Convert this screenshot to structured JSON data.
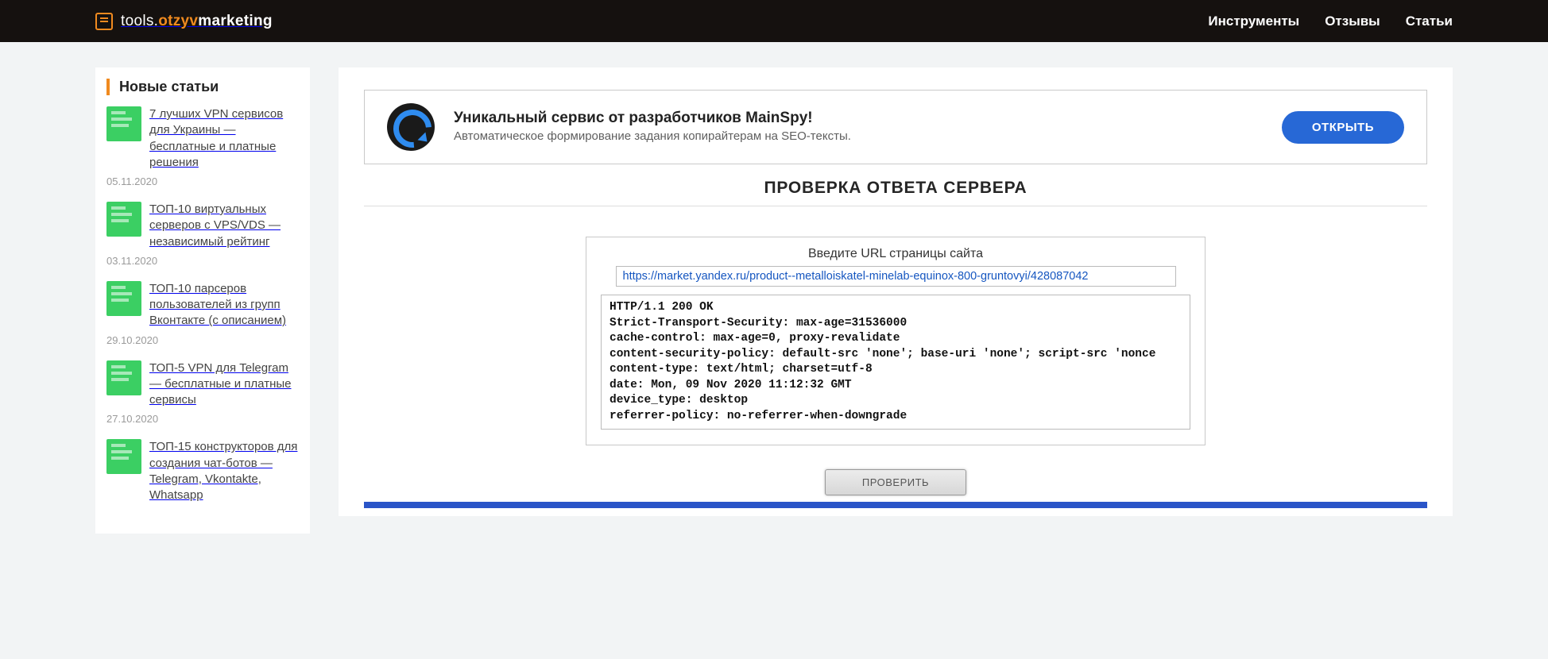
{
  "brand": {
    "pre": "tools.",
    "accent": "otzyv",
    "post": "marketing"
  },
  "nav": [
    "Инструменты",
    "Отзывы",
    "Статьи"
  ],
  "sidebar": {
    "heading": "Новые статьи",
    "items": [
      {
        "title": "7 лучших VPN сервисов для Украины — бесплатные и платные решения",
        "date": "05.11.2020"
      },
      {
        "title": "ТОП-10 виртуальных серверов с VPS/VDS — независимый рейтинг",
        "date": "03.11.2020"
      },
      {
        "title": "ТОП-10 парсеров пользователей из групп Вконтакте (с описанием)",
        "date": "29.10.2020"
      },
      {
        "title": "ТОП-5 VPN для Telegram — бесплатные и платные сервисы",
        "date": "27.10.2020"
      },
      {
        "title": "ТОП-15 конструкторов для создания чат-ботов — Telegram, Vkontakte, Whatsapp",
        "date": ""
      }
    ]
  },
  "promo": {
    "title": "Уникальный сервис от разработчиков MainSpy!",
    "sub": "Автоматическое формирование задания копирайтерам на SEO-тексты.",
    "button": "ОТКРЫТЬ"
  },
  "page_title": "ПРОВЕРКА ОТВЕТА СЕРВЕРА",
  "tool": {
    "label": "Введите URL страницы сайта",
    "url": "https://market.yandex.ru/product--metalloiskatel-minelab-equinox-800-gruntovyi/428087042",
    "response": "HTTP/1.1 200 OK\nStrict-Transport-Security: max-age=31536000\ncache-control: max-age=0, proxy-revalidate\ncontent-security-policy: default-src 'none'; base-uri 'none'; script-src 'nonce\ncontent-type: text/html; charset=utf-8\ndate: Mon, 09 Nov 2020 11:12:32 GMT\ndevice_type: desktop\nreferrer-policy: no-referrer-when-downgrade\n",
    "check": "ПРОВЕРИТЬ"
  }
}
